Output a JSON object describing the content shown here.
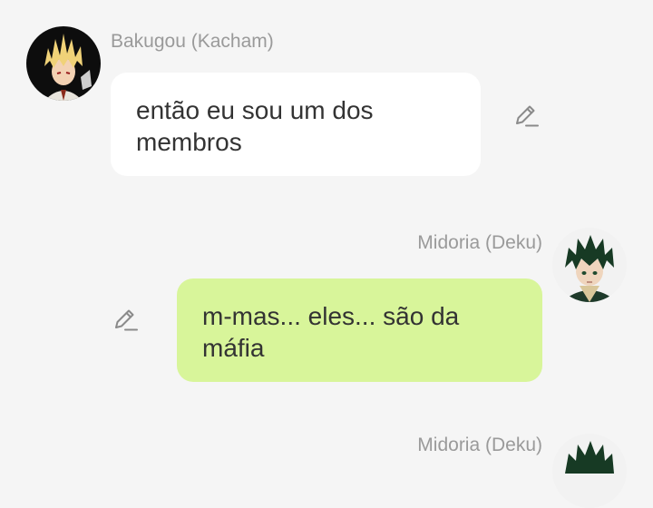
{
  "messages": [
    {
      "sender": "Bakugou (Kacham)",
      "text": "então eu sou um dos membros",
      "direction": "incoming",
      "avatar_icon": "bakugou-avatar-icon"
    },
    {
      "sender": "Midoria (Deku)",
      "text": "m-mas... eles... são da máfia",
      "direction": "outgoing",
      "avatar_icon": "midoriya-avatar-icon"
    },
    {
      "sender": "Midoria (Deku)",
      "text": "",
      "direction": "outgoing",
      "avatar_icon": "midoriya-avatar-icon"
    }
  ],
  "actions": {
    "edit_icon": "pencil-icon"
  },
  "colors": {
    "background": "#f5f5f5",
    "incoming_bubble": "#ffffff",
    "outgoing_bubble": "#d8f59a",
    "sender_name": "#9a9a9a",
    "message_text": "#333333"
  }
}
